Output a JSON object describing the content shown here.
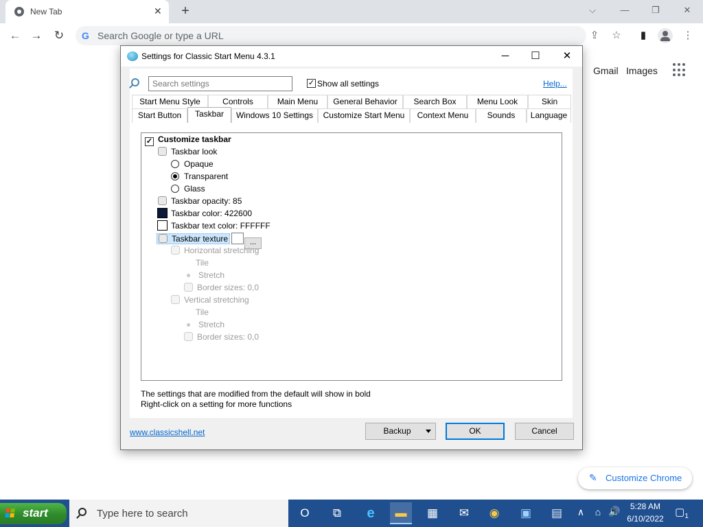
{
  "browser": {
    "tab_title": "New Tab",
    "tab_close": "✕",
    "new_tab": "+",
    "window_controls": {
      "minimize": "⌵",
      "restore_min": "—",
      "restore": "❐",
      "close": "✕"
    },
    "nav": {
      "back": "←",
      "forward": "→",
      "reload": "↻"
    },
    "omnibox_placeholder": "Search Google or type a URL",
    "omnibox_icon": "G",
    "toolbar_icons": {
      "share": "⇪",
      "bookmark": "☆",
      "side_panel": "▮",
      "menu": "⋮"
    },
    "page_links": {
      "gmail": "Gmail",
      "images": "Images"
    },
    "customize_label": "Customize Chrome",
    "customize_icon": "✎"
  },
  "dialog": {
    "title": "Settings for Classic Start Menu 4.3.1",
    "controls": {
      "minimize": "─",
      "maximize": "☐",
      "close": "✕"
    },
    "search_placeholder": "Search settings",
    "show_all_label": "Show all settings",
    "show_all_checked": "✓",
    "help_label": "Help...",
    "tabs_row1": [
      "Start Menu Style",
      "Controls",
      "Main Menu",
      "General Behavior",
      "Search Box",
      "Menu Look",
      "Skin"
    ],
    "tabs_row2": [
      "Start Button",
      "Taskbar",
      "Windows 10 Settings",
      "Customize Start Menu",
      "Context Menu",
      "Sounds",
      "Language"
    ],
    "active_tab": "Taskbar",
    "tree": {
      "customize_taskbar": "Customize taskbar",
      "customize_checked": "✓",
      "taskbar_look": "Taskbar look",
      "opaque": "Opaque",
      "transparent": "Transparent",
      "glass": "Glass",
      "opacity": "Taskbar opacity: 85",
      "color": "Taskbar color: 422600",
      "color_hex": "#0b1a3a",
      "text_color": "Taskbar text color: FFFFFF",
      "text_color_hex": "#ffffff",
      "texture": "Taskbar texture",
      "texture_btn": "...",
      "h_stretch": "Horizontal stretching",
      "h_tile": "Tile",
      "h_stretch_opt": "Stretch",
      "h_border": "Border sizes: 0,0",
      "v_stretch": "Vertical stretching",
      "v_tile": "Tile",
      "v_stretch_opt": "Stretch",
      "v_border": "Border sizes: 0,0"
    },
    "info_line1": "The settings that are modified from the default will show in bold",
    "info_line2": "Right-click on a setting for more functions",
    "site_link": "www.classicshell.net",
    "backup_label": "Backup",
    "ok_label": "OK",
    "cancel_label": "Cancel"
  },
  "taskbar": {
    "start_label": "start",
    "search_placeholder": "Type here to search",
    "icons": {
      "cortana": "O",
      "task_view": "⧉",
      "edge": "e",
      "explorer": "▬",
      "store": "▦",
      "mail": "✉",
      "chrome": "◉",
      "app1": "▣",
      "app2": "▤"
    },
    "tray": {
      "chevron": "∧",
      "network": "⌂",
      "volume": "🔊",
      "notification": "▢"
    },
    "time": "5:28 AM",
    "date": "6/10/2022",
    "notification_count": "1"
  }
}
